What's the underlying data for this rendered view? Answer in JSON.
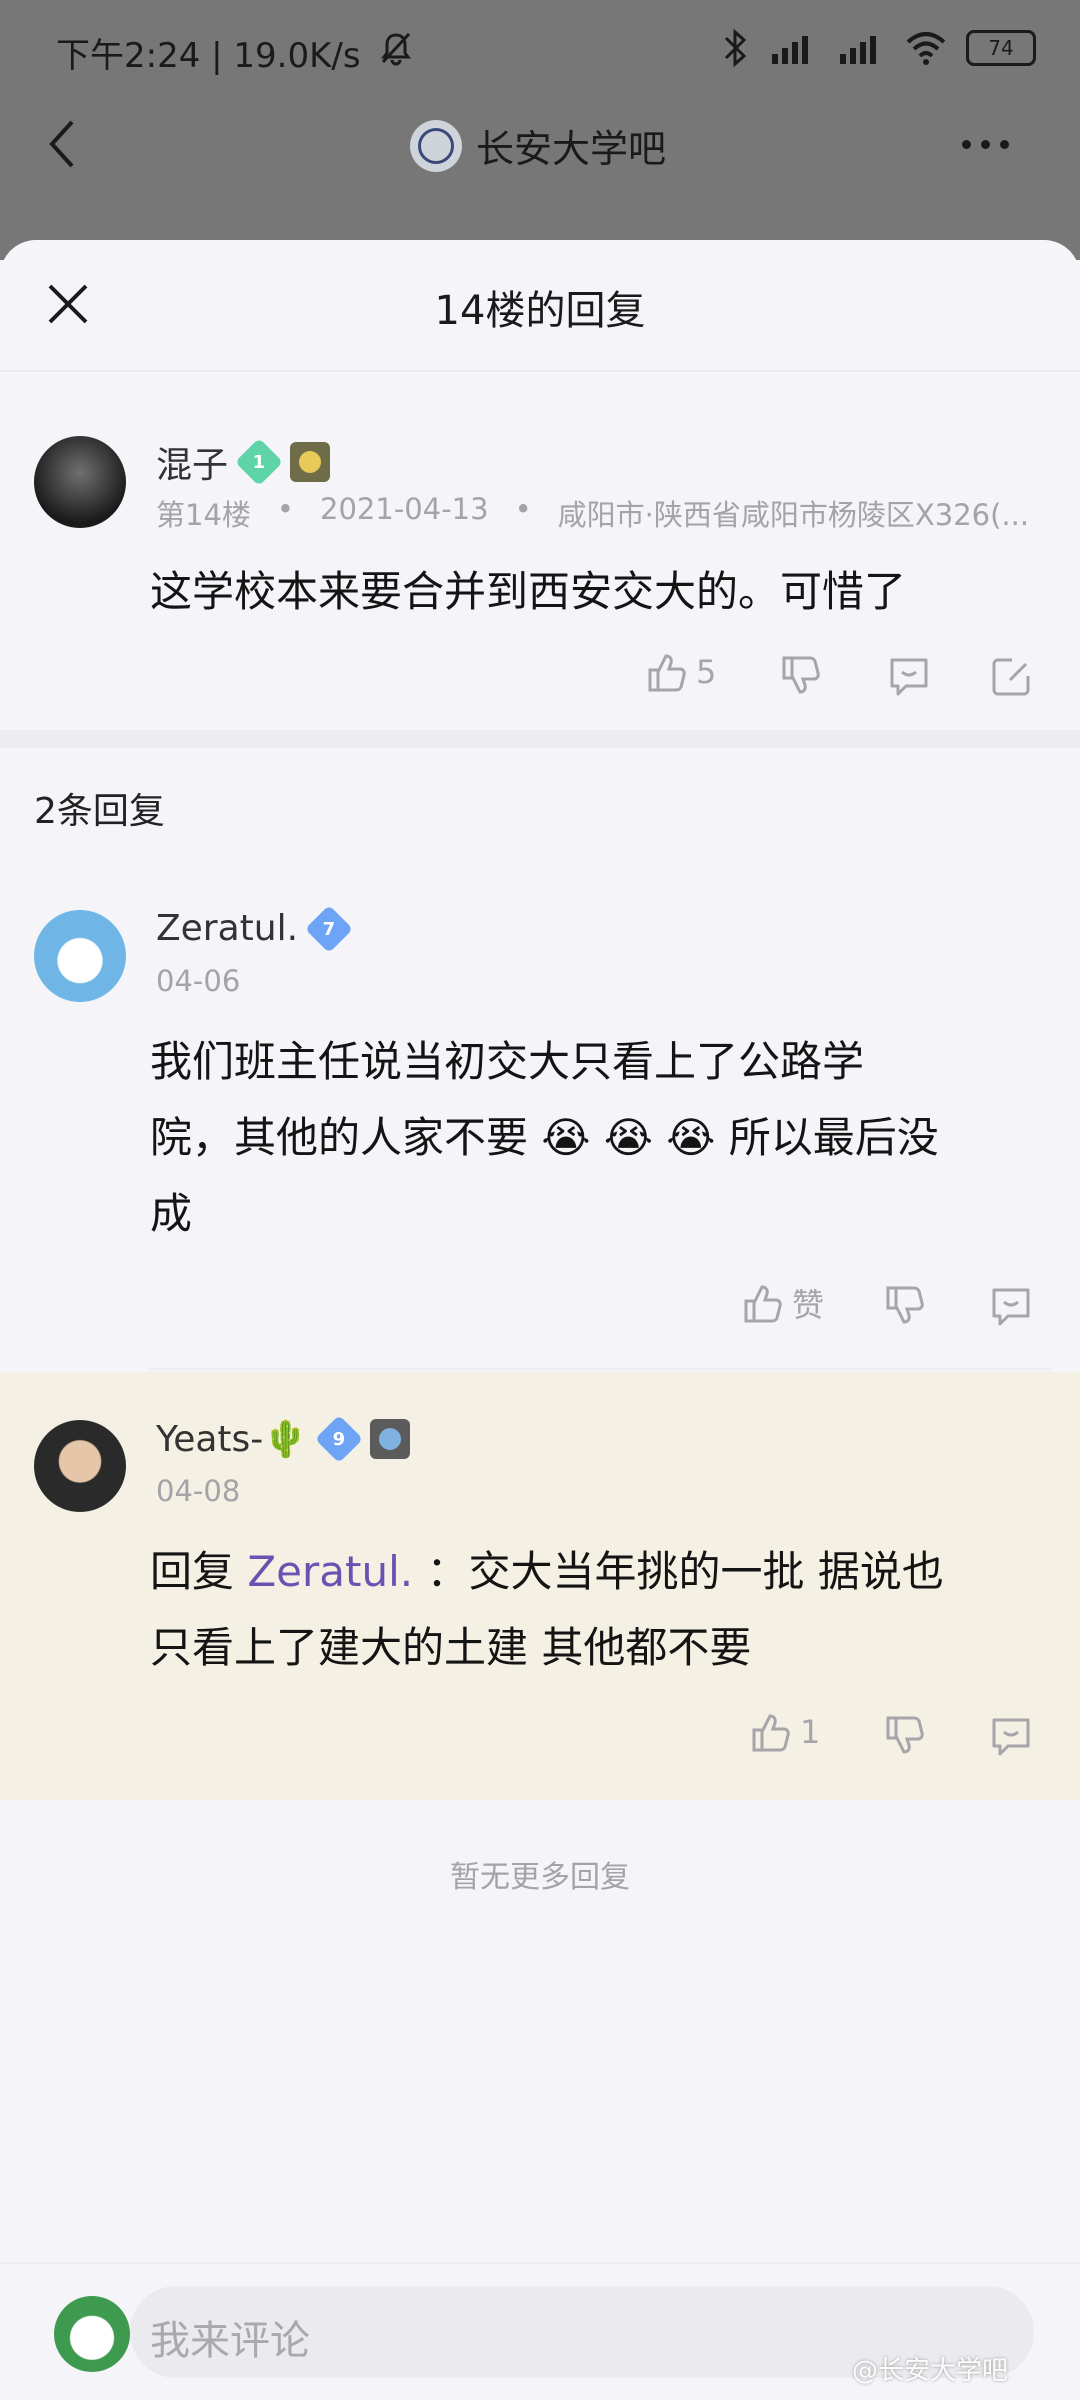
{
  "status_bar": {
    "time_speed": "下午2:24 | 19.0K/s",
    "battery": "74"
  },
  "header": {
    "title": "长安大学吧"
  },
  "sheet": {
    "title": "14楼的回复"
  },
  "main_post": {
    "username": "混子",
    "level": "1",
    "floor": "第14楼",
    "date": "2021-04-13",
    "location": "咸阳市·陕西省咸阳市杨陵区X326(...",
    "content": "这学校本来要合并到西安交大的。可惜了",
    "like_count": "5"
  },
  "replies_header": "2条回复",
  "replies": [
    {
      "username": "Zeratul.",
      "level": "7",
      "date": "04-06",
      "content_line1": "我们班主任说当初交大只看上了公路学",
      "content_line2_a": "院，其他的人家不要",
      "emoji": "😭",
      "content_line2_b": "所以最后没",
      "content_line3": "成",
      "like_label": "赞"
    },
    {
      "username": "Yeats-",
      "username_emoji": "🌵",
      "level": "9",
      "date": "04-08",
      "reply_prefix": "回复",
      "reply_target": "Zeratul.",
      "content_line1": "：交大当年挑的一批 据说也",
      "content_line2": "只看上了建大的土建 其他都不要",
      "like_count": "1"
    }
  ],
  "no_more": "暂无更多回复",
  "comment_input": {
    "placeholder": "我来评论"
  },
  "watermark": "@长安大学吧",
  "colors": {
    "highlight_bg": "#f5f0e4",
    "link": "#6a52b3",
    "badge_green": "#5fd4a8",
    "badge_blue": "#6ea4f5"
  }
}
